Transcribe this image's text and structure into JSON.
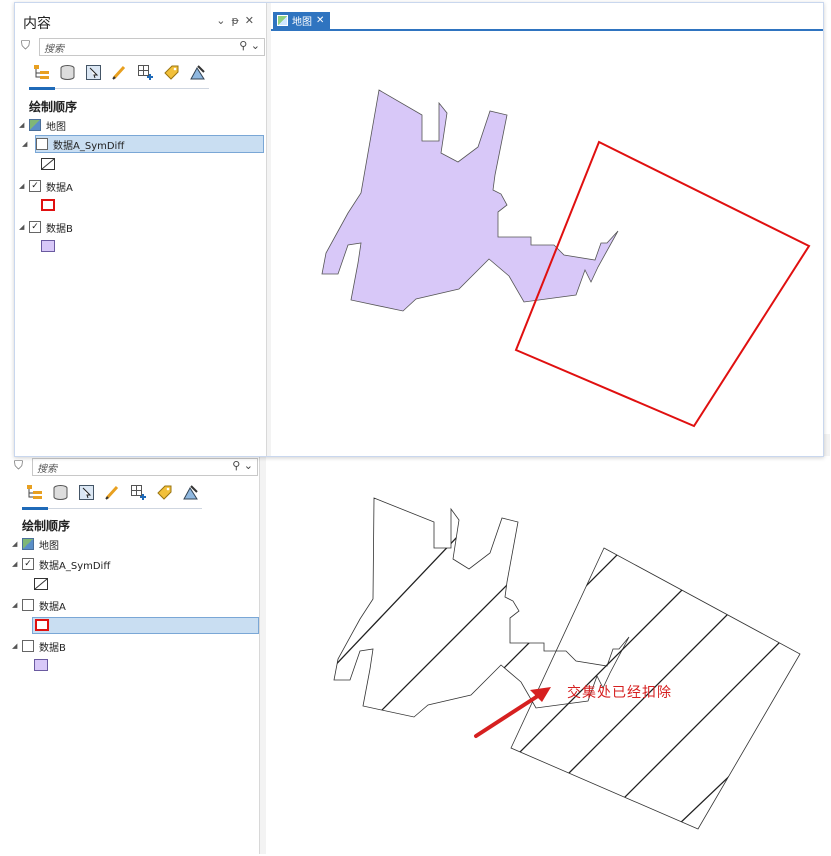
{
  "top": {
    "panel_title": "内容",
    "header_icons": [
      "chevron-down",
      "pin",
      "close"
    ],
    "search_placeholder": "搜索",
    "toolbar_icons": [
      "list-by-drawing-order-icon",
      "list-by-source-icon",
      "list-by-selection-icon",
      "list-by-editing-icon",
      "list-by-snapping-icon",
      "list-by-labeling-icon",
      "list-by-perspective-icon"
    ],
    "section_title": "绘制顺序",
    "tree": {
      "map_label": "地图",
      "layers": [
        {
          "label": "数据A_SymDiff",
          "checked": false,
          "selected": true
        },
        {
          "label": "数据A",
          "checked": true,
          "selected": false
        },
        {
          "label": "数据B",
          "checked": true,
          "selected": false
        }
      ]
    },
    "map_tab_label": "地图"
  },
  "bottom": {
    "search_placeholder": "搜索",
    "section_title": "绘制顺序",
    "tree": {
      "map_label": "地图",
      "layers": [
        {
          "label": "数据A_SymDiff",
          "checked": true,
          "selected": false
        },
        {
          "label": "数据A",
          "checked": false,
          "selected": true
        },
        {
          "label": "数据B",
          "checked": false,
          "selected": false
        }
      ]
    },
    "annotation": "交集处已经扣除"
  },
  "colors": {
    "layer_a_stroke": "#e01010",
    "layer_b_fill": "#d8c8f8",
    "accent": "#2f74c0"
  }
}
